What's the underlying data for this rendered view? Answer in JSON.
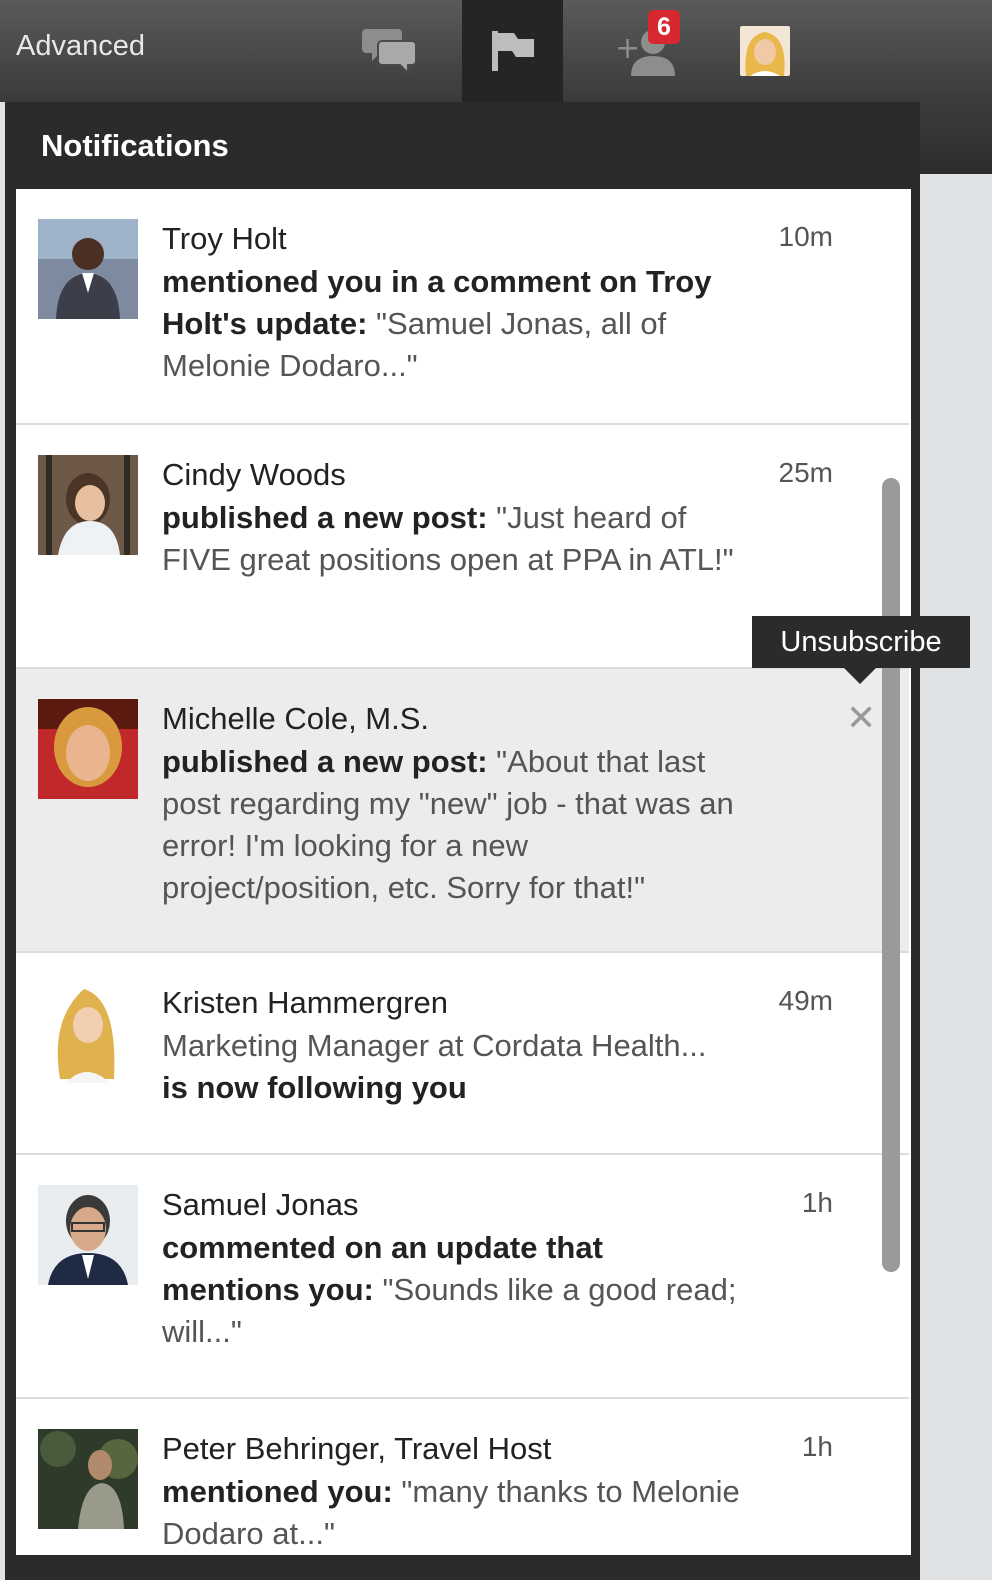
{
  "topbar": {
    "advanced_label": "Advanced",
    "badge_count": "6",
    "icons": [
      "messages-icon",
      "flag-icon",
      "add-connection-icon",
      "profile-avatar"
    ]
  },
  "panel": {
    "title": "Notifications"
  },
  "tooltip": {
    "label": "Unsubscribe"
  },
  "notifications": [
    {
      "name": "Troy Holt",
      "action": "mentioned you in a comment on Troy Holt's update:",
      "snippet": "\"Samuel Jonas, all of Melonie Dodaro...\"",
      "time": "10m"
    },
    {
      "name": "Cindy Woods",
      "action": "published a new post:",
      "snippet": "\"Just heard of FIVE great positions open at PPA in ATL!\"",
      "time": "25m"
    },
    {
      "name": "Michelle Cole, M.S.",
      "action": "published a new post:",
      "snippet": "\"About that last post regarding my \"new\" job - that was an error! I'm looking for a new project/position, etc. Sorry for that!\"",
      "time": ""
    },
    {
      "name": "Kristen Hammergren",
      "subtitle": "Marketing Manager at Cordata Health...",
      "action": "is now following you",
      "time": "49m"
    },
    {
      "name": "Samuel Jonas",
      "action": "commented on an update that mentions you:",
      "snippet": "\"Sounds like a good read; will...\"",
      "time": "1h"
    },
    {
      "name": "Peter Behringer, Travel Host",
      "action": "mentioned you:",
      "snippet": "\"many thanks to Melonie Dodaro at...\"",
      "time": "1h"
    }
  ],
  "colors": {
    "badge": "#d7282f",
    "panel": "#2b2b2b",
    "hover_row": "#ececec"
  }
}
